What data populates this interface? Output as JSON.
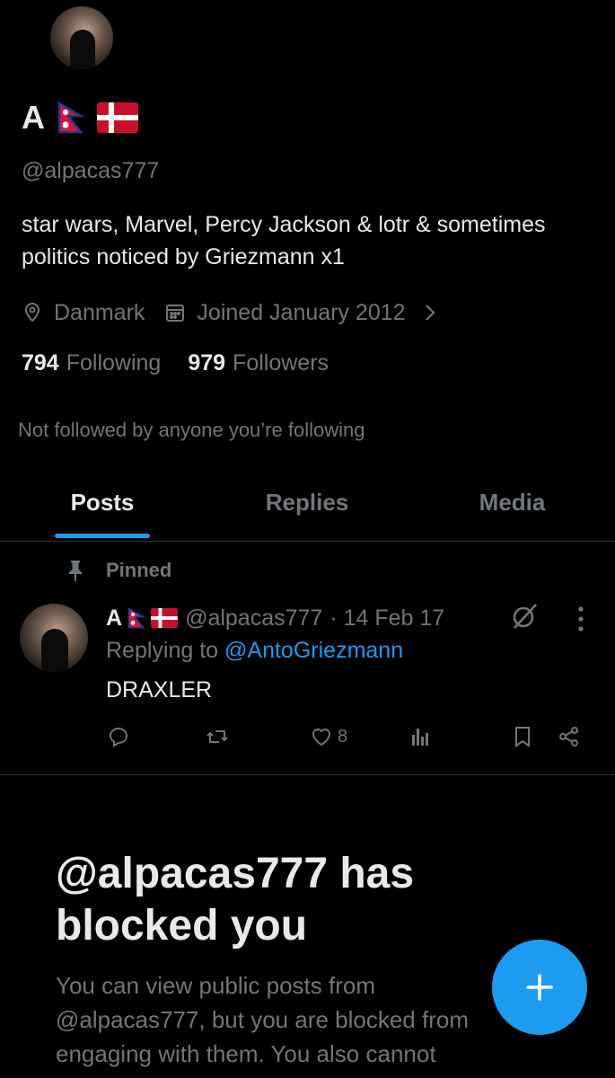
{
  "profile": {
    "name": "A",
    "handle": "@alpacas777",
    "bio": "star wars, Marvel, Percy Jackson & lotr & sometimes politics noticed by Griezmann x1",
    "location": "Danmark",
    "joined": "Joined January 2012",
    "following_count": "794",
    "following_label": "Following",
    "followers_count": "979",
    "followers_label": "Followers",
    "not_followed": "Not followed by anyone you’re following"
  },
  "tabs": [
    {
      "label": "Posts",
      "active": true
    },
    {
      "label": "Replies",
      "active": false
    },
    {
      "label": "Media",
      "active": false
    }
  ],
  "pinned_tweet": {
    "pinned_label": "Pinned",
    "author_name": "A",
    "handle": "@alpacas777",
    "date": "· 14 Feb 17",
    "replying_prefix": "Replying to",
    "replying_to": "@AntoGriezmann",
    "text": "DRAXLER",
    "like_count": "8"
  },
  "blocked": {
    "title": "@alpacas777 has blocked you",
    "body": "You can view public posts from @alpacas777, but you are blocked from engaging with them. You also cannot"
  },
  "colors": {
    "background": "#000000",
    "accent": "#1d9bf0",
    "text_primary": "#e7e9ea",
    "text_secondary": "#71767b"
  }
}
